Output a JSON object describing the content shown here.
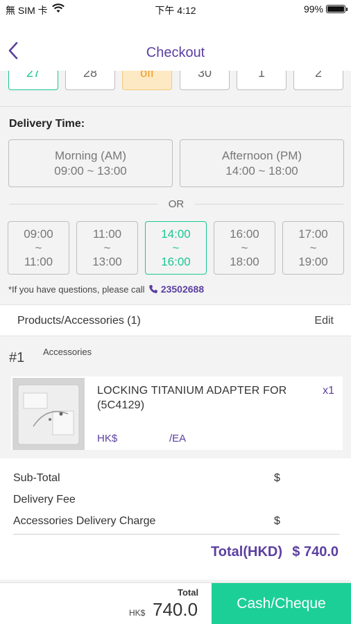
{
  "status_bar": {
    "carrier": "無 SIM 卡",
    "time": "下午 4:12",
    "battery": "99%"
  },
  "nav": {
    "title": "Checkout"
  },
  "dates": {
    "items": [
      "27",
      "28",
      "off",
      "30",
      "1",
      "2"
    ]
  },
  "delivery_time": {
    "label": "Delivery Time:",
    "periods": [
      {
        "name": "Morning (AM)",
        "range": "09:00 ~ 13:00"
      },
      {
        "name": "Afternoon (PM)",
        "range": "14:00 ~ 18:00"
      }
    ],
    "or_text": "OR",
    "slots": [
      {
        "start": "09:00",
        "sep": "~",
        "end": "11:00"
      },
      {
        "start": "11:00",
        "sep": "~",
        "end": "13:00"
      },
      {
        "start": "14:00",
        "sep": "~",
        "end": "16:00"
      },
      {
        "start": "16:00",
        "sep": "~",
        "end": "18:00"
      },
      {
        "start": "17:00",
        "sep": "~",
        "end": "19:00"
      }
    ],
    "selected_slot": "14:00 ~ 16:00",
    "note": "*If you have questions, please call",
    "phone": "23502688"
  },
  "products": {
    "header": "Products/Accessories (1)",
    "edit_label": "Edit",
    "items": [
      {
        "index": "#1",
        "category": "Accessories",
        "name": "LOCKING TITANIUM ADAPTER FOR (5C4129)",
        "qty": "x1",
        "currency": "HK$",
        "unit": "/EA"
      }
    ]
  },
  "summary": {
    "subtotal_label": "Sub-Total",
    "subtotal_value": "$",
    "delivery_fee_label": "Delivery Fee",
    "accessories_charge_label": "Accessories Delivery Charge",
    "accessories_charge_value": "$",
    "total_label": "Total(HKD)",
    "total_value": "$ 740.0"
  },
  "footer": {
    "total_label": "Total",
    "currency": "HK$",
    "amount": "740.0",
    "pay_button": "Cash/Cheque"
  },
  "colors": {
    "brand_purple": "#5b3fa0",
    "accent_green": "#1cc694",
    "off_orange": "#f29a20"
  }
}
